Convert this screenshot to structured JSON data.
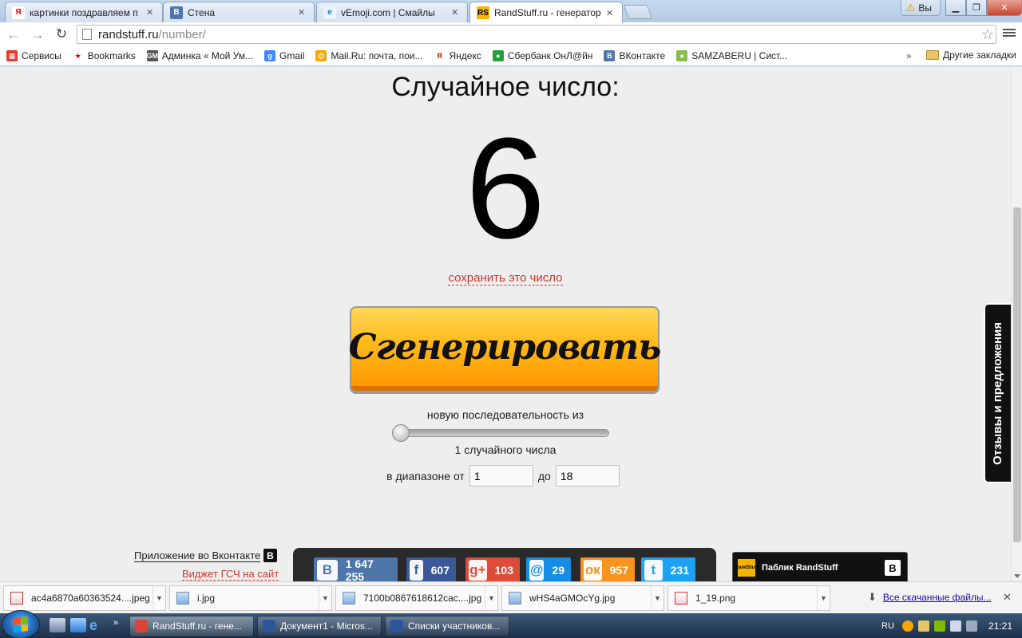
{
  "tabs": [
    {
      "title": "картинки поздравляем п",
      "icon": "yandex-icon",
      "icon_text": "Я",
      "color": "#ffffff",
      "text_color": "#e30000"
    },
    {
      "title": "Стена",
      "icon": "vk-icon",
      "icon_text": "B",
      "color": "#4e76a8",
      "text_color": "#ffffff"
    },
    {
      "title": "vEmoji.com | Смайлы",
      "icon": "ie-page-icon",
      "icon_text": "e",
      "color": "#e9f4ff",
      "text_color": "#1c6fd1"
    },
    {
      "title": "RandStuff.ru - генератор",
      "icon": "randstuff-icon",
      "icon_text": "RS",
      "color": "#f4b400",
      "text_color": "#000000"
    }
  ],
  "profile": {
    "label": "Вы"
  },
  "toolbar": {
    "url_host": "randstuff.ru",
    "url_path": "/number/"
  },
  "bookmarks": [
    {
      "label": "Сервисы",
      "icon": "apps-grid-icon",
      "icon_text": "▦",
      "color": "#e33b2e"
    },
    {
      "label": "Bookmarks",
      "icon": "star-icon",
      "icon_text": "★",
      "color": "#ffffff"
    },
    {
      "label": "Админка « Мой Ум...",
      "icon": "admin-icon",
      "icon_text": "GM",
      "color": "#555555"
    },
    {
      "label": "Gmail",
      "icon": "google-icon",
      "icon_text": "g",
      "color": "#4285f4"
    },
    {
      "label": "Mail.Ru: почта, пои...",
      "icon": "mailru-icon",
      "icon_text": "@",
      "color": "#f7a600"
    },
    {
      "label": "Яндекс",
      "icon": "yandex-icon",
      "icon_text": "Я",
      "color": "#ffffff"
    },
    {
      "label": "Сбербанк ОнЛ@йн",
      "icon": "sberbank-icon",
      "icon_text": "●",
      "color": "#21a038"
    },
    {
      "label": "ВКонтакте",
      "icon": "vk-icon",
      "icon_text": "B",
      "color": "#4e76a8"
    },
    {
      "label": "SAMZABERU | Сист...",
      "icon": "globe-icon",
      "icon_text": "●",
      "color": "#8bbd4a"
    }
  ],
  "bookmarks_more": "»",
  "bookmarks_other": "Другие закладки",
  "main": {
    "heading": "Случайное число:",
    "number": "6",
    "save_link": "сохранить это число",
    "generate_button": "Сгенерировать",
    "sequence_label": "новую последовательность из",
    "slider_value": 1,
    "count_label": "1 случайного числа",
    "range_from_label": "в диапазоне от",
    "range_from_value": "1",
    "range_to_label": "до",
    "range_to_value": "18",
    "vk_app_link": "Приложение во Вконтакте",
    "widget_link": "Виджет ГСЧ на сайт",
    "feedback_tab": "Отзывы и предложения",
    "public_label": "Паблик RandStuff"
  },
  "social": [
    {
      "name": "vk-share-button",
      "icon": "vk-icon",
      "icon_text": "B",
      "count": "1 647 255",
      "color": "#4e76a8"
    },
    {
      "name": "facebook-share-button",
      "icon": "facebook-icon",
      "icon_text": "f",
      "count": "607",
      "color": "#3b5998"
    },
    {
      "name": "googleplus-share-button",
      "icon": "googleplus-icon",
      "icon_text": "g+",
      "count": "103",
      "color": "#dd4b39"
    },
    {
      "name": "mailru-share-button",
      "icon": "mailru-icon",
      "icon_text": "@",
      "count": "29",
      "color": "#168de2"
    },
    {
      "name": "odnoklassniki-share-button",
      "icon": "odnoklassniki-icon",
      "icon_text": "ок",
      "count": "957",
      "color": "#f7931e"
    },
    {
      "name": "twitter-share-button",
      "icon": "twitter-icon",
      "icon_text": "t",
      "count": "231",
      "color": "#1da1f2"
    }
  ],
  "downloads": [
    {
      "file": "ac4a6870a60363524....jpeg",
      "icon": "image-file-icon",
      "red": true
    },
    {
      "file": "i.jpg",
      "icon": "image-file-icon",
      "red": false
    },
    {
      "file": "7100b0867618612cac....jpg",
      "icon": "image-file-icon",
      "red": false
    },
    {
      "file": "wHS4aGMOcYg.jpg",
      "icon": "image-file-icon",
      "red": false
    },
    {
      "file": "1_19.png",
      "icon": "image-file-icon",
      "red": true
    }
  ],
  "downloads_all": "Все скачанные файлы...",
  "taskbar": {
    "tasks": [
      {
        "label": "RandStuff.ru - гене...",
        "icon": "chrome-icon",
        "color": "#db4437",
        "active": true
      },
      {
        "label": "Документ1 - Micros...",
        "icon": "word-icon",
        "color": "#2b579a",
        "active": false
      },
      {
        "label": "Списки участников...",
        "icon": "word-icon",
        "color": "#2b579a",
        "active": false
      }
    ],
    "lang": "RU",
    "clock": "21:21"
  }
}
